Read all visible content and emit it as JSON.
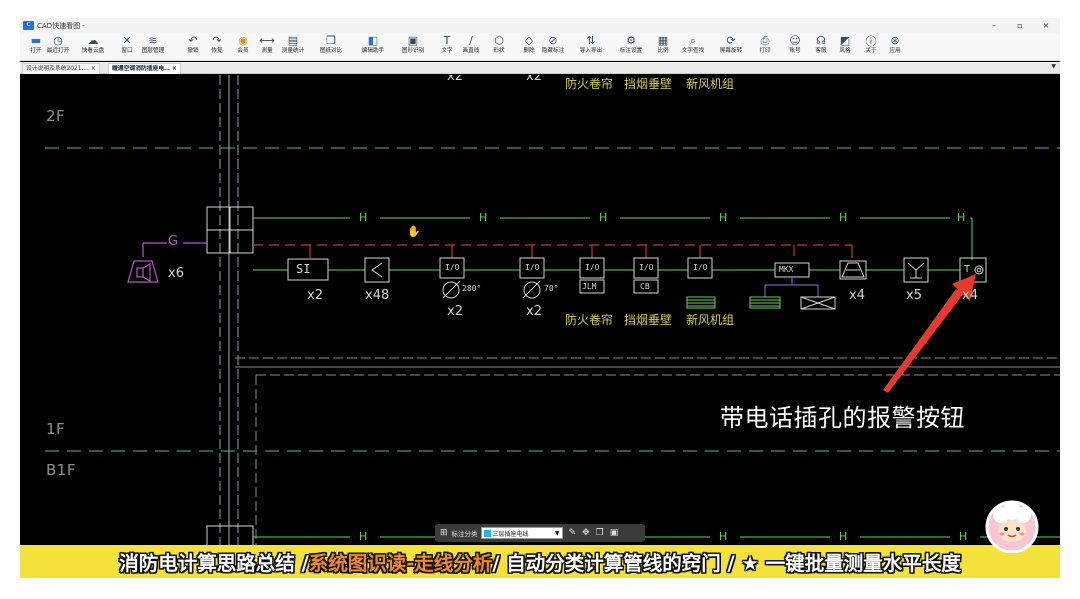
{
  "window": {
    "title": "CAD快速看图 -",
    "controls": [
      "–",
      "▫",
      "×"
    ]
  },
  "toolbar": {
    "items": [
      {
        "label": "打开",
        "icon": "folder-icon"
      },
      {
        "label": "最近打开",
        "icon": "history-icon"
      },
      {
        "label": "快看云盘",
        "icon": "cloud-icon"
      },
      {
        "label": "窗口",
        "icon": "window-icon"
      },
      {
        "label": "图层管理",
        "icon": "layers-icon"
      },
      {
        "label": "撤销",
        "icon": "undo-icon"
      },
      {
        "label": "恢复",
        "icon": "redo-icon"
      },
      {
        "label": "会员",
        "icon": "vip-icon"
      },
      {
        "label": "测量",
        "icon": "measure-icon"
      },
      {
        "label": "测量统计",
        "icon": "measure-stats-icon"
      },
      {
        "label": "图纸对比",
        "icon": "compare-icon"
      },
      {
        "label": "编辑助手",
        "icon": "edit-assistant-icon"
      },
      {
        "label": "图形识别",
        "icon": "shape-recognize-icon"
      },
      {
        "label": "文字",
        "icon": "text-icon"
      },
      {
        "label": "画直线",
        "icon": "line-icon"
      },
      {
        "label": "形状",
        "icon": "shape-icon"
      },
      {
        "label": "删除",
        "icon": "eraser-icon"
      },
      {
        "label": "隐藏标注",
        "icon": "hide-markup-icon"
      },
      {
        "label": "导入导出",
        "icon": "import-export-icon"
      },
      {
        "label": "标注设置",
        "icon": "markup-settings-icon"
      },
      {
        "label": "比例",
        "icon": "scale-icon"
      },
      {
        "label": "文字查找",
        "icon": "text-search-icon"
      },
      {
        "label": "屏幕旋转",
        "icon": "rotate-icon"
      },
      {
        "label": "打印",
        "icon": "print-icon"
      },
      {
        "label": "账号",
        "icon": "account-icon"
      },
      {
        "label": "客服",
        "icon": "support-icon"
      },
      {
        "label": "风格",
        "icon": "style-icon"
      },
      {
        "label": "关于",
        "icon": "about-icon"
      },
      {
        "label": "应用",
        "icon": "apps-icon"
      }
    ]
  },
  "doc_tabs": [
    {
      "label": "设计说明及系统2021.…",
      "active": false
    },
    {
      "label": "暖通空调消防插座电…",
      "active": true
    }
  ],
  "drawing": {
    "floors": [
      "2F",
      "1F",
      "B1F"
    ],
    "top_partial_text": [
      "x2",
      "x2",
      "防火卷帘",
      "挡烟垂壁",
      "新风机组"
    ],
    "line_labels": {
      "h": "H",
      "g": "G"
    },
    "symbols": [
      {
        "code": "SI",
        "count": "x2"
      },
      {
        "code": "<",
        "count": "x48"
      },
      {
        "code": "I/O",
        "note": "280°",
        "count": "x2"
      },
      {
        "code": "I/O",
        "note": "70°",
        "count": "x2"
      },
      {
        "code": "I/O",
        "sub": "JLM",
        "caption": "防火卷帘"
      },
      {
        "code": "I/O",
        "sub": "CB",
        "caption": "挡烟垂壁"
      },
      {
        "code": "I/O",
        "caption": "新风机组"
      },
      {
        "code": "MKX"
      },
      {
        "code": "fire-alarm",
        "count": "x4"
      },
      {
        "code": "Y",
        "count": "x5"
      },
      {
        "code": "T",
        "count": "x4"
      }
    ],
    "speaker_count": "x6",
    "annotation": "带电话插孔的报警按钮"
  },
  "floatbar": {
    "label": "标注分类",
    "value": "三层插座电线"
  },
  "banner": {
    "part1": "消防电计算思路总结 / ",
    "part2": "系统图识读-走线分析",
    "part3": " / 自动分类计算管线的窍门 / ★ 一键批量测量水平长度"
  },
  "colors": {
    "canvas": "#000000",
    "green_line": "#5fd35a",
    "red_dashed": "#c03a3a",
    "magenta": "#b857c8",
    "yellow_text": "#d6cc57",
    "cyan_dash": "#4fb3b8",
    "banner_bg": "#f3e13c",
    "banner_highlight": "#f0882c"
  }
}
